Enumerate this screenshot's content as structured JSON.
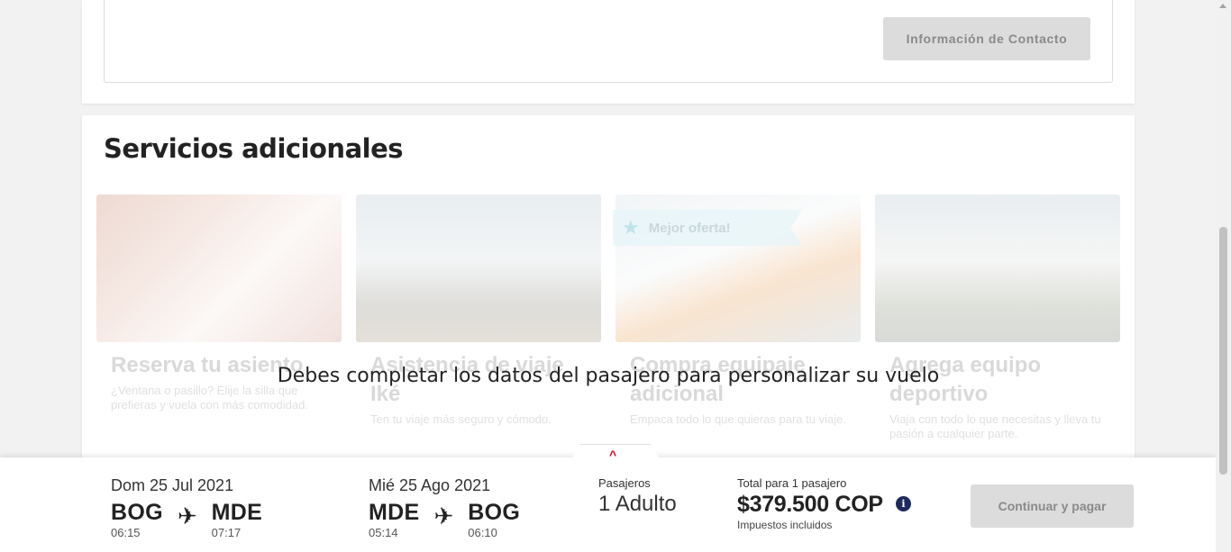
{
  "contact": {
    "button_label": "Información de Contacto"
  },
  "services": {
    "title": "Servicios adicionales",
    "badge": "Mejor oferta!",
    "cards": [
      {
        "title": "Reserva tu asiento",
        "desc": "¿Ventana o pasillo? Elije la silla que prefieras y vuela con más comodidad."
      },
      {
        "title": "Asistencia de viaje Iké",
        "desc": "Ten tu viaje más seguro y cómodo."
      },
      {
        "title": "Compra equipaje adicional",
        "desc": "Empaca todo lo que quieras para tu viaje."
      },
      {
        "title": "Agrega equipo deportivo",
        "desc": "Viaja con todo lo que necesitas y lleva tu pasión a cualquier parte."
      }
    ],
    "overlay_message": "Debes completar los datos del pasajero para personalizar su vuelo"
  },
  "summary": {
    "outbound": {
      "date": "Dom 25 Jul 2021",
      "from": "BOG",
      "from_time": "06:15",
      "to": "MDE",
      "to_time": "07:17"
    },
    "return": {
      "date": "Mié 25 Ago 2021",
      "from": "MDE",
      "from_time": "05:14",
      "to": "BOG",
      "to_time": "06:10"
    },
    "passengers_label": "Pasajeros",
    "passengers_value": "1 Adulto",
    "total_label": "Total para 1 pasajero",
    "total_price": "$379.500 COP",
    "taxes_note": "Impuestos incluidos",
    "pay_button": "Continuar y pagar"
  },
  "icons": {
    "plane": "plane-icon",
    "info": "info-icon",
    "star": "star-icon",
    "chevron": "chevron-up-icon"
  }
}
